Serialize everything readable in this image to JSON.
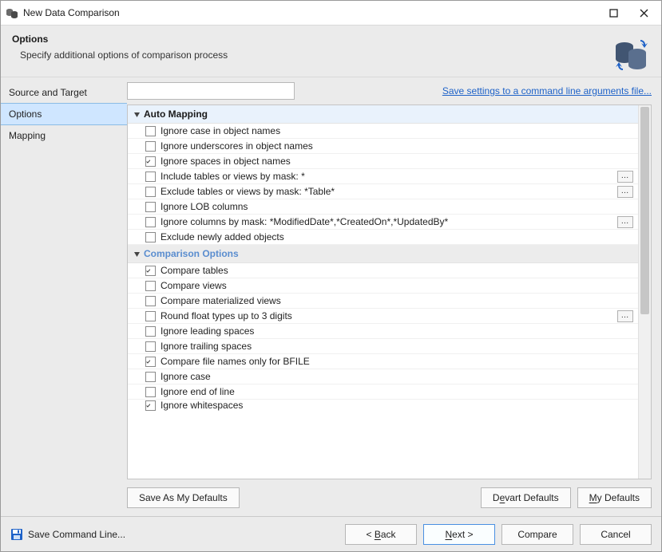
{
  "window": {
    "title": "New Data Comparison"
  },
  "header": {
    "title": "Options",
    "subtitle": "Specify additional options of comparison process"
  },
  "leftnav": {
    "items": [
      {
        "id": "source",
        "label": "Source and Target",
        "selected": false
      },
      {
        "id": "options",
        "label": "Options",
        "selected": true
      },
      {
        "id": "mapping",
        "label": "Mapping",
        "selected": false
      }
    ]
  },
  "toprow": {
    "filter_value": "",
    "filter_placeholder": "",
    "save_link": "Save settings to a command line arguments file..."
  },
  "groups": {
    "auto_mapping": {
      "title": "Auto Mapping",
      "rows": [
        {
          "id": "ign-case-obj",
          "label": "Ignore case in object names",
          "checked": false,
          "dots": false
        },
        {
          "id": "ign-under-obj",
          "label": "Ignore underscores in object names",
          "checked": false,
          "dots": false
        },
        {
          "id": "ign-space-obj",
          "label": "Ignore spaces in object names",
          "checked": true,
          "dots": false
        },
        {
          "id": "include-mask",
          "label": "Include tables or views by mask: *",
          "checked": false,
          "dots": true
        },
        {
          "id": "exclude-mask",
          "label": "Exclude tables or views by mask: *Table*",
          "checked": false,
          "dots": true
        },
        {
          "id": "ign-lob",
          "label": "Ignore LOB columns",
          "checked": false,
          "dots": false
        },
        {
          "id": "ign-cols-mask",
          "label": "Ignore columns by mask: *ModifiedDate*,*CreatedOn*,*UpdatedBy*",
          "checked": false,
          "dots": true
        },
        {
          "id": "excl-new",
          "label": "Exclude newly added objects",
          "checked": false,
          "dots": false
        }
      ]
    },
    "comparison": {
      "title": "Comparison Options",
      "rows": [
        {
          "id": "cmp-tables",
          "label": "Compare tables",
          "checked": true,
          "dots": false
        },
        {
          "id": "cmp-views",
          "label": "Compare views",
          "checked": false,
          "dots": false
        },
        {
          "id": "cmp-mviews",
          "label": "Compare materialized views",
          "checked": false,
          "dots": false
        },
        {
          "id": "round-float",
          "label": "Round float types up to 3 digits",
          "checked": false,
          "dots": true
        },
        {
          "id": "ign-lead-sp",
          "label": "Ignore leading spaces",
          "checked": false,
          "dots": false
        },
        {
          "id": "ign-trail-sp",
          "label": "Ignore trailing spaces",
          "checked": false,
          "dots": false
        },
        {
          "id": "cmp-bfile",
          "label": "Compare file names only for BFILE",
          "checked": true,
          "dots": false
        },
        {
          "id": "ign-case",
          "label": "Ignore case",
          "checked": false,
          "dots": false
        },
        {
          "id": "ign-eol",
          "label": "Ignore end of line",
          "checked": false,
          "dots": false
        }
      ],
      "cutoff_row": {
        "id": "ign-ws",
        "label": "Ignore whitespaces",
        "checked": true
      }
    }
  },
  "under_buttons": {
    "save_defaults": "Save As My Defaults",
    "devart_defaults_pre": "D",
    "devart_defaults_u": "e",
    "devart_defaults_post": "vart Defaults",
    "my_defaults_u": "M",
    "my_defaults_post": "y Defaults"
  },
  "bottom": {
    "save_cmd": "Save Command Line...",
    "back_pre": "< ",
    "back_u": "B",
    "back_post": "ack",
    "next_u": "N",
    "next_post": "ext >",
    "compare": "Compare",
    "cancel": "Cancel"
  }
}
